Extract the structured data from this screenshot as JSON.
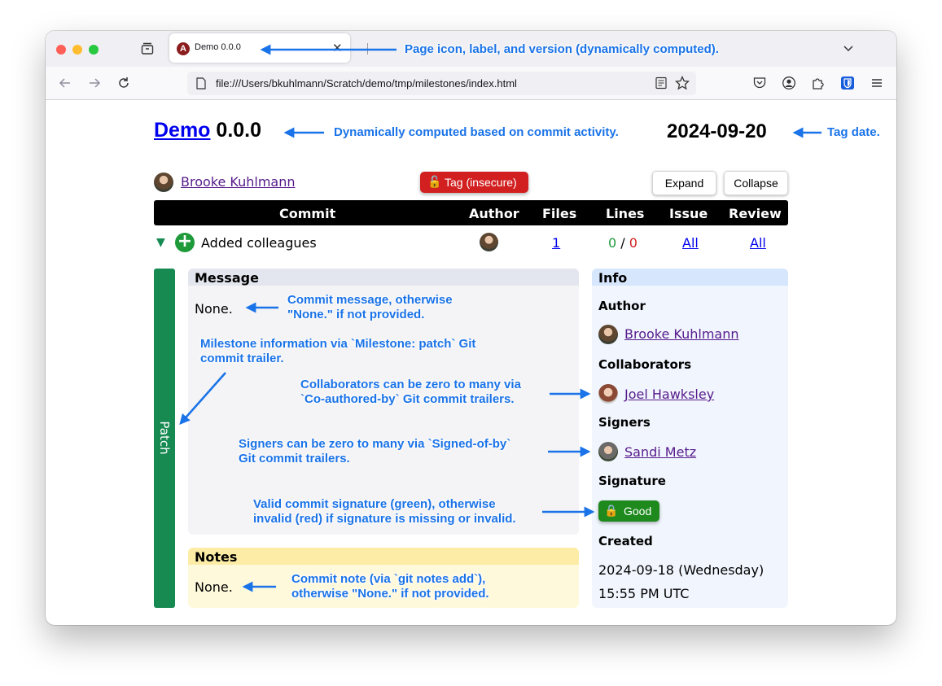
{
  "browser": {
    "tab_title": "Demo 0.0.0",
    "tab_favicon_letter": "A",
    "url": "file:///Users/bkuhlmann/Scratch/demo/tmp/milestones/index.html",
    "icons": [
      "back-icon",
      "forward-icon",
      "reload-icon",
      "tab-overview-icon",
      "close-icon",
      "chevron-down-icon",
      "page-icon",
      "reader-view-icon",
      "bookmark-star-icon",
      "pocket-icon",
      "account-icon",
      "extensions-icon",
      "bitwarden-icon",
      "menu-icon"
    ]
  },
  "page": {
    "title_link": "Demo",
    "version": "0.0.0",
    "tag_date": "2024-09-20",
    "tagger": {
      "name": "Brooke Kuhlmann"
    },
    "tag_badge": "Tag (insecure)",
    "expand_label": "Expand",
    "collapse_label": "Collapse",
    "table_headers": [
      "Commit",
      "Author",
      "Files",
      "Lines",
      "Issue",
      "Review"
    ],
    "commit": {
      "toggle": "▼",
      "label": "Added colleagues",
      "files": "1",
      "lines_added": "0",
      "lines_separator": "/",
      "lines_deleted": "0",
      "issue": "All",
      "review": "All",
      "milestone": "Patch"
    },
    "message": {
      "heading": "Message",
      "body": "None."
    },
    "notes": {
      "heading": "Notes",
      "body": "None."
    },
    "info": {
      "heading": "Info",
      "author_label": "Author",
      "author": "Brooke Kuhlmann",
      "collaborators_label": "Collaborators",
      "collaborator": "Joel Hawksley",
      "signers_label": "Signers",
      "signer": "Sandi Metz",
      "signature_label": "Signature",
      "signature": "Good",
      "created_label": "Created",
      "created_date": "2024-09-18",
      "created_day": "(Wednesday)",
      "created_time": "15:55 PM",
      "created_zone": "UTC"
    }
  },
  "annotations": {
    "page_icon": "Page icon, label, and version (dynamically computed).",
    "version": "Dynamically computed based on commit activity.",
    "tag_date": "Tag date.",
    "message_line1": "Commit message, otherwise",
    "message_line2": "\"None.\" if not provided.",
    "milestone_line1": "Milestone information via `Milestone: patch` Git",
    "milestone_line2": "commit trailer.",
    "collab_line1": "Collaborators can be zero to many via",
    "collab_line2": "`Co-authored-by` Git commit trailers.",
    "signers_line1": "Signers can be zero to many via `Signed-of-by`",
    "signers_line2": "Git commit trailers.",
    "signature_line1": "Valid commit signature (green), otherwise",
    "signature_line2": "invalid (red) if signature is missing or invalid.",
    "notes_line1": "Commit note (via `git notes add`),",
    "notes_line2": "otherwise \"None.\" if not provided."
  },
  "colors": {
    "accent": "#1a73e8",
    "patch": "#178a52",
    "insecure": "#d21f1f",
    "good": "#1e8a1e"
  }
}
